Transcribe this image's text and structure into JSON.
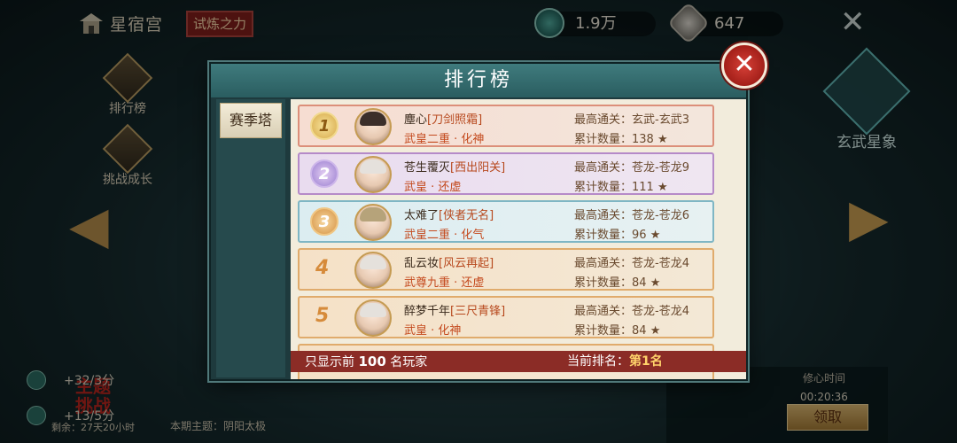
{
  "top_bar": {
    "home_label": "星宿宫",
    "trial_tag": "试炼之力",
    "resource1": "1.9万",
    "resource2": "647",
    "close_glyph": "✕"
  },
  "side_nav": [
    {
      "label": "排行榜"
    },
    {
      "label": "挑战成长"
    }
  ],
  "constellation_label": "玄武星象",
  "theme": {
    "title_line1": "主题",
    "title_line2": "挑战",
    "remaining": "剩余：27天20小时",
    "current": "本期主题：阴阳太极"
  },
  "rewards": {
    "line1": "+32/3分",
    "line2": "+13/5分",
    "timer_label": "修心时间",
    "timer_value": "00:20:36",
    "claim_label": "领取"
  },
  "modal": {
    "title": "排行榜",
    "close_glyph": "✕",
    "tab": "赛季塔",
    "best_prefix": "最高通关：",
    "count_prefix": "累计数量：",
    "star_glyph": "★",
    "rows": [
      {
        "rank": "1",
        "name": "塵心",
        "guild": "[刀剑照霜]",
        "realm": "武皇二重 · 化神",
        "best": "玄武-玄武3",
        "count": "138"
      },
      {
        "rank": "2",
        "name": "苍生覆灭",
        "guild": "[西出阳关]",
        "realm": "武皇 · 还虚",
        "best": "苍龙-苍龙9",
        "count": "111"
      },
      {
        "rank": "3",
        "name": "太难了",
        "guild": "[侠者无名]",
        "realm": "武皇二重 · 化气",
        "best": "苍龙-苍龙6",
        "count": "96"
      },
      {
        "rank": "4",
        "name": "乱云妆",
        "guild": "[风云再起]",
        "realm": "武尊九重 · 还虚",
        "best": "苍龙-苍龙4",
        "count": "84"
      },
      {
        "rank": "5",
        "name": "醉梦千年",
        "guild": "[三尺青锋]",
        "realm": "武皇 · 化神",
        "best": "苍龙-苍龙4",
        "count": "84"
      }
    ],
    "footer_left_a": "只显示前",
    "footer_left_num": "100",
    "footer_left_b": "名玩家",
    "footer_right_label": "当前排名：",
    "footer_right_value": "第1名"
  }
}
